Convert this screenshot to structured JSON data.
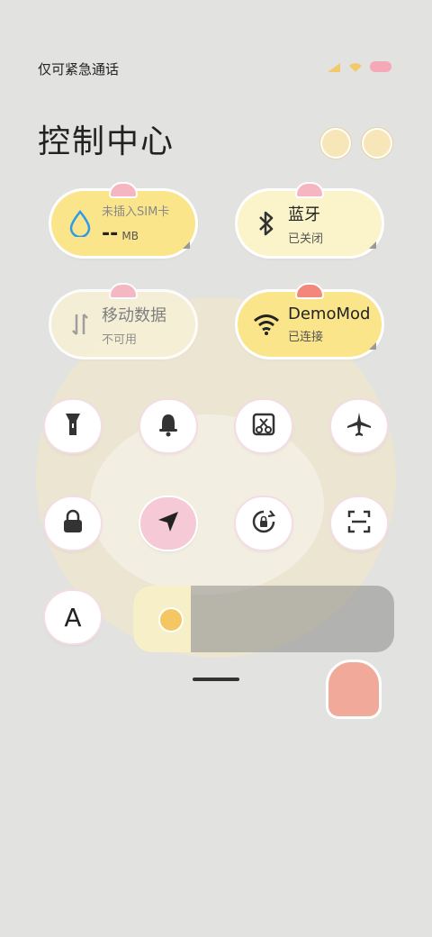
{
  "status": {
    "left_text": "仅可紧急通话"
  },
  "header": {
    "title": "控制中心"
  },
  "cards": {
    "data": {
      "line1": "未插入SIM卡",
      "line2_value": "--",
      "line2_unit": "MB",
      "icon": "water-drop-icon"
    },
    "bluetooth": {
      "line1": "蓝牙",
      "line2": "已关闭",
      "icon": "bluetooth-icon"
    },
    "mobile": {
      "line1": "移动数据",
      "line2": "不可用",
      "icon": "mobile-data-icon"
    },
    "wifi": {
      "line1": "DemoMod",
      "line2": "已连接",
      "icon": "wifi-icon"
    }
  },
  "tiles": [
    {
      "name": "flashlight",
      "icon": "flashlight-icon"
    },
    {
      "name": "bell",
      "icon": "bell-icon"
    },
    {
      "name": "screenshot",
      "icon": "screenshot-icon"
    },
    {
      "name": "airplane",
      "icon": "airplane-icon"
    },
    {
      "name": "lock",
      "icon": "lock-icon"
    },
    {
      "name": "location",
      "icon": "location-arrow-icon",
      "active": true
    },
    {
      "name": "rotation",
      "icon": "rotation-lock-icon"
    },
    {
      "name": "scan",
      "icon": "scan-icon"
    },
    {
      "name": "font",
      "icon": "font-a-icon",
      "label": "A"
    }
  ],
  "brightness": {
    "level": 0.22
  },
  "colors": {
    "card_yellow": "#fbe58b",
    "card_pale": "#f6f0d6",
    "tile_active": "#f6c9d6",
    "accent_blue": "#2d9be8"
  }
}
